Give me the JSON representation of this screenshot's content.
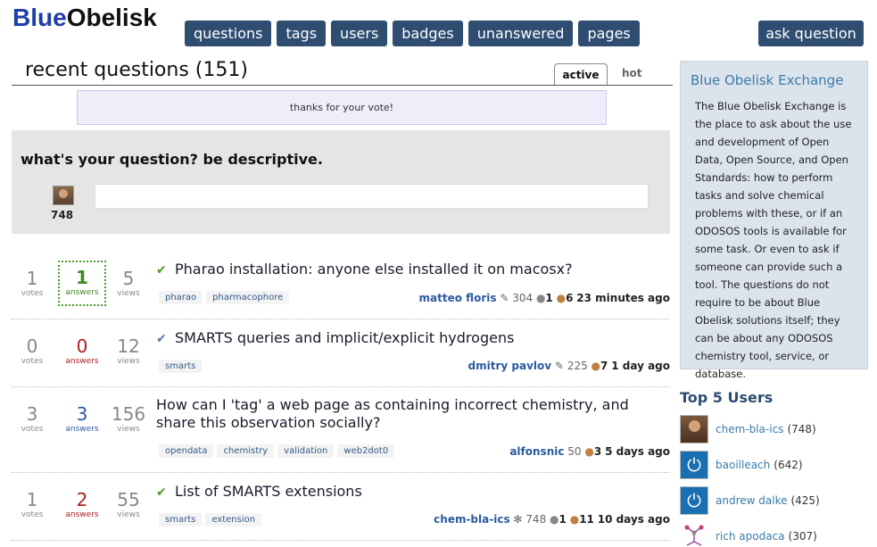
{
  "logo": {
    "part1": "Blue",
    "part2": "Obelisk"
  },
  "nav": [
    "questions",
    "tags",
    "users",
    "badges",
    "unanswered",
    "pages"
  ],
  "ask_button": "ask question",
  "heading": "recent questions (151)",
  "tabs": {
    "active": "active",
    "other": "hot"
  },
  "notice": "thanks for your vote!",
  "askbox": {
    "title": "what's your question? be descriptive.",
    "score": "748",
    "input_value": ""
  },
  "questions": [
    {
      "votes": "1",
      "votes_label": "votes",
      "answers": "1",
      "answers_label": "answers",
      "views": "5",
      "views_label": "views",
      "title": "Pharao installation: anyone else installed it on macosx?",
      "tags": [
        "pharao",
        "pharmacophore"
      ],
      "user": "matteo floris",
      "rep": "304",
      "badge1": "1",
      "badge2": "6",
      "time": "23 minutes ago"
    },
    {
      "votes": "0",
      "votes_label": "votes",
      "answers": "0",
      "answers_label": "answers",
      "views": "12",
      "views_label": "views",
      "title": "SMARTS queries and implicit/explicit hydrogens",
      "tags": [
        "smarts"
      ],
      "user": "dmitry pavlov",
      "rep": "225",
      "badge2": "7",
      "time": "1 day ago"
    },
    {
      "votes": "3",
      "votes_label": "votes",
      "answers": "3",
      "answers_label": "answers",
      "views": "156",
      "views_label": "views",
      "title": "How can I 'tag' a web page as containing incorrect chemistry, and share this observation socially?",
      "tags": [
        "opendata",
        "chemistry",
        "validation",
        "web2dot0"
      ],
      "user": "alfonsnic",
      "rep": "50",
      "badge2": "3",
      "time": "5 days ago"
    },
    {
      "votes": "1",
      "votes_label": "votes",
      "answers": "2",
      "answers_label": "answers",
      "views": "55",
      "views_label": "views",
      "title": "List of SMARTS extensions",
      "tags": [
        "smarts",
        "extension"
      ],
      "user": "chem-bla-ics",
      "rep": "748",
      "badge1": "1",
      "badge2": "11",
      "time": "10 days ago"
    }
  ],
  "sidebar": {
    "title": "Blue Obelisk Exchange",
    "text": "The Blue Obelisk Exchange is the place to ask about the use and development of Open Data, Open Source, and Open Standards: how to perform tasks and solve chemical problems with these, or if an ODOSOS tools is available for some task. Or even to ask if someone can provide such a tool. The questions do not require to be about Blue Obelisk solutions itself; they can be about any ODOSOS chemistry tool, service, or database."
  },
  "top_users": {
    "title": "Top 5 Users",
    "users": [
      {
        "name": "chem-bla-ics",
        "score": "(748)"
      },
      {
        "name": "baoilleach",
        "score": "(642)"
      },
      {
        "name": "andrew dalke",
        "score": "(425)"
      },
      {
        "name": "rich apodaca",
        "score": "(307)"
      }
    ]
  },
  "colors": {
    "nav_bg": "#2e4d71",
    "accent_green": "#3d8a22",
    "accent_red": "#b02020",
    "link_blue": "#2a5aa0"
  }
}
